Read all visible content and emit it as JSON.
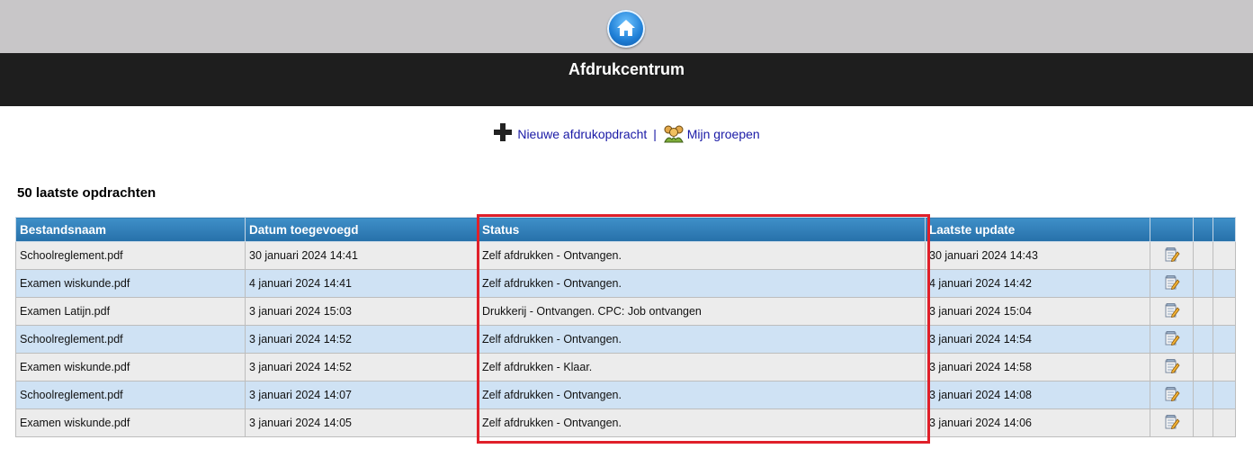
{
  "header": {
    "title": "Afdrukcentrum"
  },
  "actions": {
    "new_job": "Nieuwe afdrukopdracht",
    "separator": "|",
    "my_groups": "Mijn groepen"
  },
  "section": {
    "title": "50 laatste opdrachten"
  },
  "table": {
    "columns": [
      "Bestandsnaam",
      "Datum toegevoegd",
      "Status",
      "Laatste update",
      "",
      "",
      ""
    ],
    "rows": [
      {
        "file": "Schoolreglement.pdf",
        "added": "30 januari 2024 14:41",
        "status": "Zelf afdrukken - Ontvangen.",
        "updated": "30 januari 2024 14:43"
      },
      {
        "file": "Examen wiskunde.pdf",
        "added": "4 januari 2024 14:41",
        "status": "Zelf afdrukken - Ontvangen.",
        "updated": "4 januari 2024 14:42"
      },
      {
        "file": "Examen Latijn.pdf",
        "added": "3 januari 2024 15:03",
        "status": "Drukkerij - Ontvangen. CPC: Job ontvangen",
        "updated": "3 januari 2024 15:04"
      },
      {
        "file": "Schoolreglement.pdf",
        "added": "3 januari 2024 14:52",
        "status": "Zelf afdrukken - Ontvangen.",
        "updated": "3 januari 2024 14:54"
      },
      {
        "file": "Examen wiskunde.pdf",
        "added": "3 januari 2024 14:52",
        "status": "Zelf afdrukken - Klaar.",
        "updated": "3 januari 2024 14:58"
      },
      {
        "file": "Schoolreglement.pdf",
        "added": "3 januari 2024 14:07",
        "status": "Zelf afdrukken - Ontvangen.",
        "updated": "3 januari 2024 14:08"
      },
      {
        "file": "Examen wiskunde.pdf",
        "added": "3 januari 2024 14:05",
        "status": "Zelf afdrukken - Ontvangen.",
        "updated": "3 januari 2024 14:06"
      }
    ]
  },
  "icons": {
    "home": "home-icon",
    "add": "plus-icon",
    "groups": "group-icon",
    "edit": "edit-icon"
  },
  "colors": {
    "highlight": "#e0202a",
    "header_blue": "#2e7fb8",
    "row_even": "#cfe2f4",
    "row_odd": "#ececec"
  }
}
